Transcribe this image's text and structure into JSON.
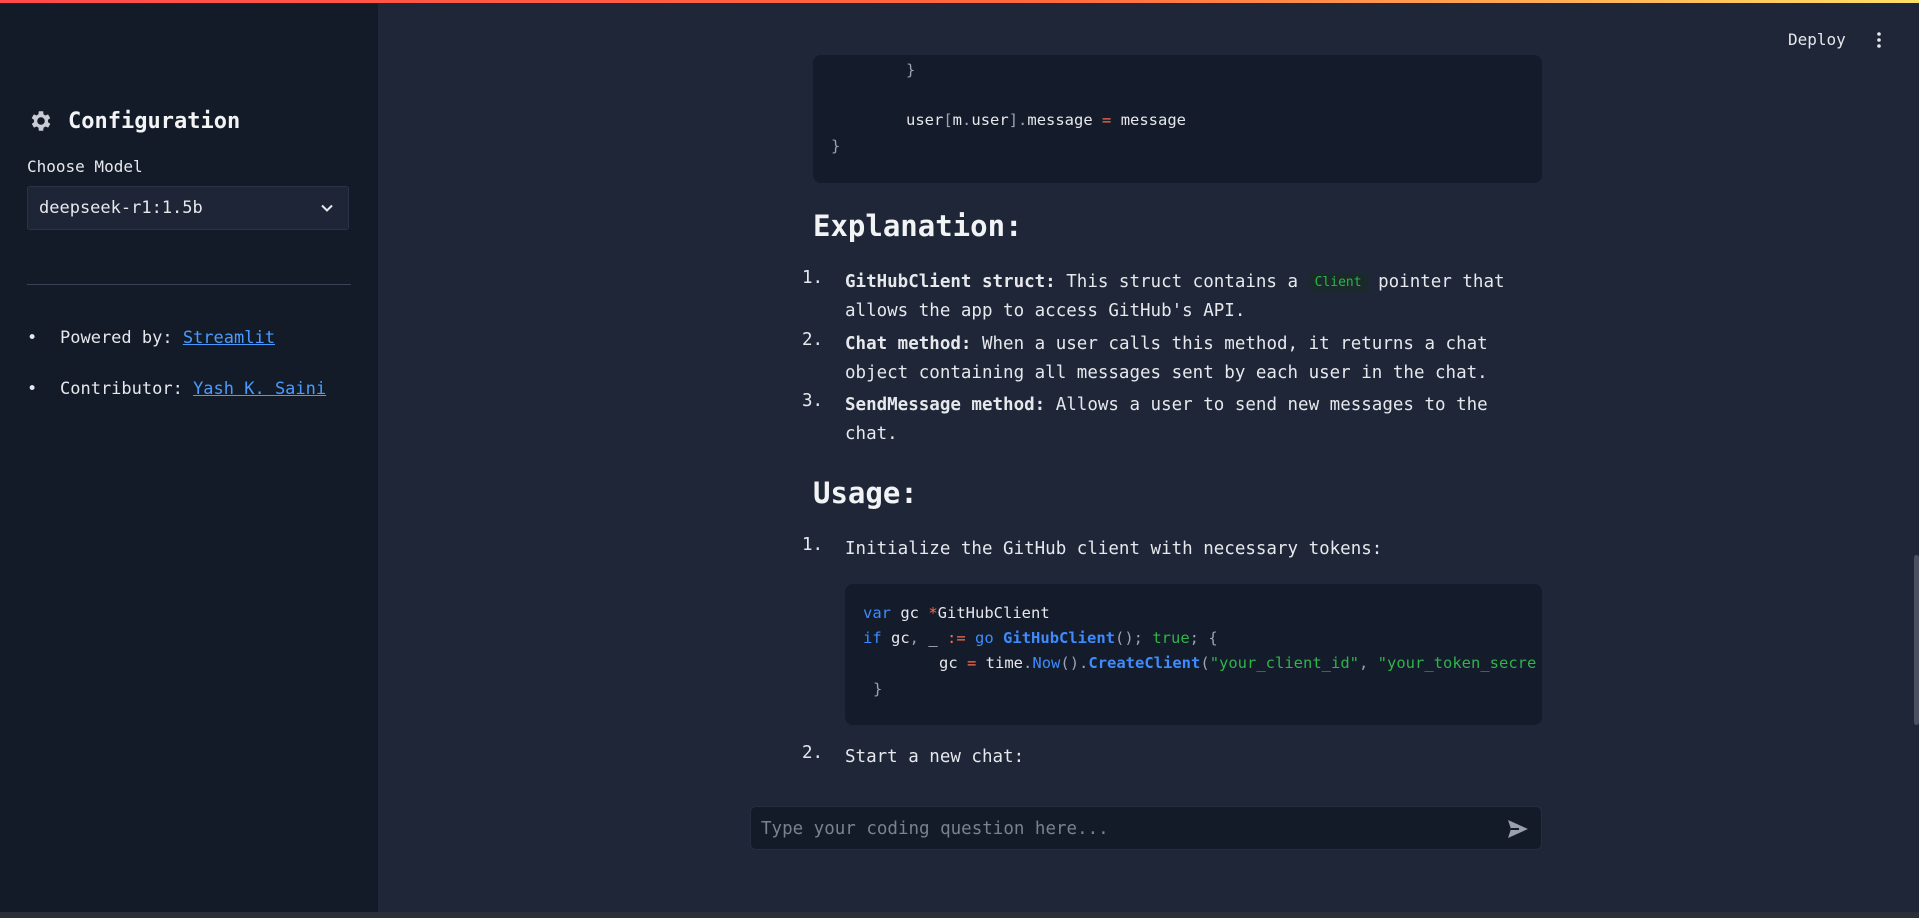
{
  "sidebar": {
    "title": "Configuration",
    "model_label": "Choose Model",
    "model_selected": "deepseek-r1:1.5b",
    "powered_by_label": "Powered by: ",
    "powered_by_link": "Streamlit",
    "contributor_label": "Contributor: ",
    "contributor_link": "Yash K. Saini"
  },
  "header": {
    "deploy_label": "Deploy"
  },
  "code_block_1": {
    "lines": [
      "}",
      "user[m.user].message = message",
      "}"
    ]
  },
  "explanation": {
    "heading": "Explanation:",
    "items": [
      {
        "num": "1.",
        "title": "GitHubClient struct:",
        "text_a": " This struct contains a ",
        "code": "Client",
        "text_b": " pointer that",
        "line2": "allows the app to access GitHub's API."
      },
      {
        "num": "2.",
        "title": "Chat method:",
        "text": " When a user calls this method, it returns a chat",
        "line2": "object containing all messages sent by each user in the chat."
      },
      {
        "num": "3.",
        "title": "SendMessage method:",
        "text": " Allows a user to send new messages to the",
        "line2": "chat."
      }
    ]
  },
  "usage": {
    "heading": "Usage:",
    "step1_num": "1.",
    "step1": "Initialize the GitHub client with necessary tokens:",
    "step2_num": "2.",
    "step2": "Start a new chat:"
  },
  "code_block_2": {
    "line1": "var gc *GitHubClient",
    "line2": "if gc, _ := go GitHubClient(); true; {",
    "line3": "gc = time.Now().CreateClient(\"your_client_id\", \"your_token_secre",
    "line4": "}"
  },
  "chat": {
    "placeholder": "Type your coding question here..."
  },
  "colors": {
    "sidebar_bg": "#141b28",
    "main_bg": "#1e2638",
    "code_bg": "#141b2b",
    "link": "#4a9bff",
    "keyword": "#3d8bfd",
    "operator": "#ff6b4a",
    "string": "#2fb34a"
  },
  "icons": {
    "config": "gear-icon",
    "select": "chevron-down-icon",
    "menu": "kebab-menu-icon",
    "send": "send-icon"
  }
}
